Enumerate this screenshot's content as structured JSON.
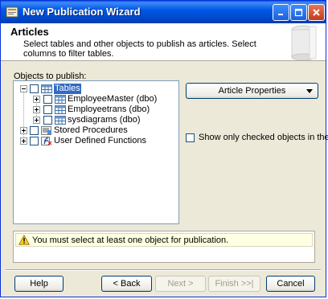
{
  "window": {
    "title": "New Publication Wizard"
  },
  "header": {
    "title": "Articles",
    "description": "Select tables and other objects to publish as articles. Select columns to filter tables."
  },
  "objects": {
    "label": "Objects to publish:",
    "tree": {
      "tables": "Tables",
      "employee_master": "EmployeeMaster (dbo)",
      "employee_trans": "Employeetrans (dbo)",
      "sysdiagrams": "sysdiagrams (dbo)",
      "stored_procedures": "Stored Procedures",
      "user_defined_functions": "User Defined Functions"
    }
  },
  "article_properties_label": "Article Properties",
  "show_only_checked_label": "Show only checked objects in the list",
  "message": "You must select at least one object for publication.",
  "buttons": {
    "help": "Help",
    "back": "< Back",
    "next": "Next >",
    "finish": "Finish >>|",
    "cancel": "Cancel"
  },
  "colors": {
    "titlebar": "#0054e3",
    "selection": "#316ac5",
    "dialog_bg": "#ece9d8",
    "warning_bg": "#ffffe1"
  }
}
